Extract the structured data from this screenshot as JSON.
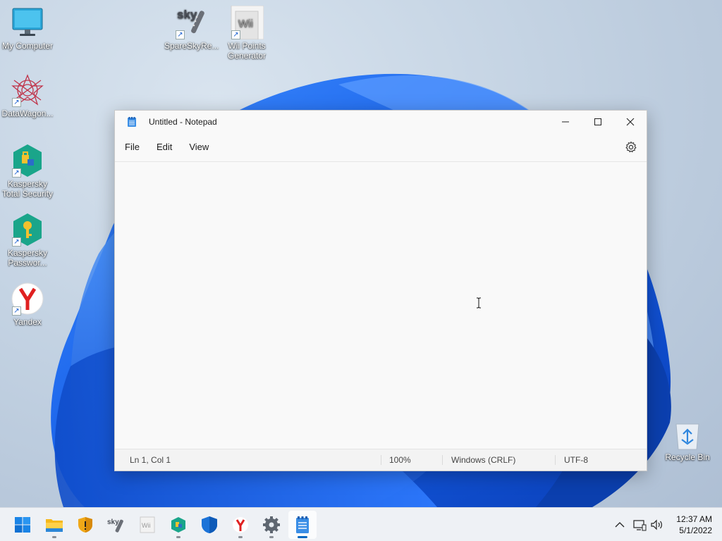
{
  "desktop": {
    "icons": [
      {
        "label": "My Computer",
        "icon": "monitor-icon"
      },
      {
        "label": "DataWagon...",
        "icon": "datawagon-icon"
      },
      {
        "label": "Kaspersky Total Security",
        "icon": "kaspersky-total-security-icon"
      },
      {
        "label": "Kaspersky Passwor...",
        "icon": "kaspersky-password-icon"
      },
      {
        "label": "Yandex",
        "icon": "yandex-icon"
      },
      {
        "label": "SpareSkyRe...",
        "icon": "sky-icon"
      },
      {
        "label": "Wii Points Generator",
        "icon": "wii-icon"
      },
      {
        "label": "Recycle Bin",
        "icon": "recycle-bin-icon"
      }
    ]
  },
  "notepad": {
    "title": "Untitled - Notepad",
    "menu": [
      "File",
      "Edit",
      "View"
    ],
    "content": "",
    "status": {
      "position": "Ln 1, Col 1",
      "zoom": "100%",
      "line_ending": "Windows (CRLF)",
      "encoding": "UTF-8"
    }
  },
  "taskbar": {
    "apps": [
      "start-icon",
      "file-explorer-icon",
      "security-shield-icon",
      "sky-icon",
      "wii-icon",
      "kaspersky-icon",
      "defender-icon",
      "yandex-icon",
      "settings-icon",
      "notepad-icon"
    ],
    "active_app": "notepad-icon",
    "tray": [
      "chevron-up-icon",
      "network-icon",
      "volume-icon"
    ],
    "clock": {
      "time": "12:37 AM",
      "date": "5/1/2022"
    }
  },
  "colors": {
    "accent": "#0067c0",
    "wallpaper_blue": "#1a5fe0"
  }
}
